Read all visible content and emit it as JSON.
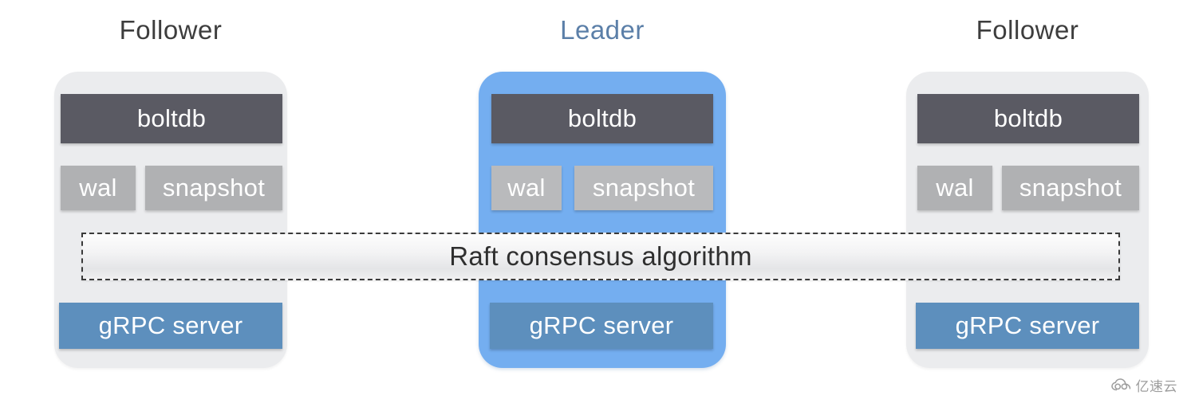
{
  "diagram": {
    "title_row": [
      {
        "label": "Follower",
        "role": "follower"
      },
      {
        "label": "Leader",
        "role": "leader"
      },
      {
        "label": "Follower",
        "role": "follower"
      }
    ],
    "nodes": [
      {
        "role": "follower",
        "title": "Follower",
        "boltdb": "boltdb",
        "wal": "wal",
        "snapshot": "snapshot",
        "grpc": "gRPC server"
      },
      {
        "role": "leader",
        "title": "Leader",
        "boltdb": "boltdb",
        "wal": "wal",
        "snapshot": "snapshot",
        "grpc": "gRPC server"
      },
      {
        "role": "follower",
        "title": "Follower",
        "boltdb": "boltdb",
        "wal": "wal",
        "snapshot": "snapshot",
        "grpc": "gRPC server"
      }
    ],
    "raft_bar": {
      "label": "Raft consensus algorithm"
    },
    "watermark": {
      "icon": "cloud-icon",
      "text": "亿速云"
    },
    "colors": {
      "leader_card": "#74aef0",
      "follower_card": "#ebecee",
      "leader_title": "#5b7fa8",
      "follower_title": "#3d3d3d",
      "boltdb": "#5a5a63",
      "wal_snapshot": "#b0b1b3",
      "grpc": "#5d8fbd",
      "raft_border": "#3a3a3a",
      "raft_text": "#2f2f2f",
      "background": "#ffffff"
    }
  }
}
